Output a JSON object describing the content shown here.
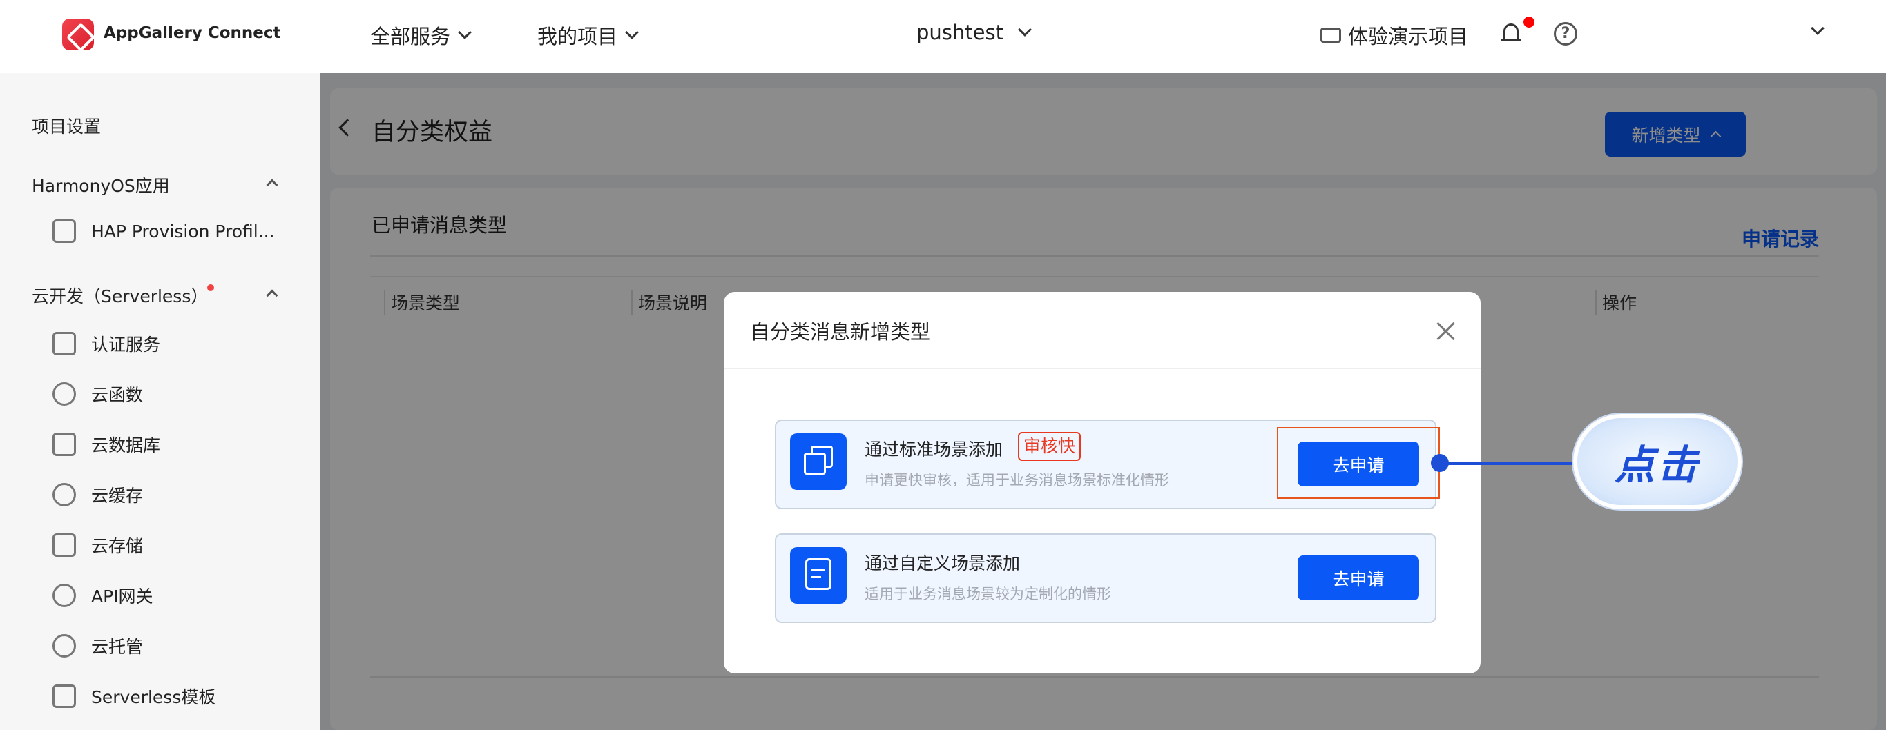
{
  "header": {
    "brand": "AppGallery Connect",
    "nav_all_services": "全部服务",
    "nav_my_projects": "我的项目",
    "project": "pushtest",
    "demo_project": "体验演示项目"
  },
  "sidebar": {
    "project_settings": "项目设置",
    "group_harmony": "HarmonyOS应用",
    "harmony_items": [
      {
        "label": "HAP Provision Profil..."
      }
    ],
    "group_serverless": "云开发（Serverless）",
    "serverless_items": [
      {
        "label": "认证服务"
      },
      {
        "label": "云函数"
      },
      {
        "label": "云数据库"
      },
      {
        "label": "云缓存"
      },
      {
        "label": "云存储"
      },
      {
        "label": "API网关"
      },
      {
        "label": "云托管"
      },
      {
        "label": "Serverless模板"
      }
    ]
  },
  "main": {
    "title": "自分类权益",
    "add_type_button": "新增类型",
    "section_title": "已申请消息类型",
    "record_link": "申请记录",
    "columns": [
      "场景类型",
      "场景说明",
      "操作"
    ]
  },
  "dialog": {
    "title": "自分类消息新增类型",
    "options": [
      {
        "name": "通过标准场景添加",
        "badge": "审核快",
        "desc": "申请更快审核，适用于业务消息场景标准化情形",
        "button": "去申请"
      },
      {
        "name": "通过自定义场景添加",
        "desc": "适用于业务消息场景较为定制化的情形",
        "button": "去申请"
      }
    ]
  },
  "annotation": {
    "text": "点击"
  }
}
